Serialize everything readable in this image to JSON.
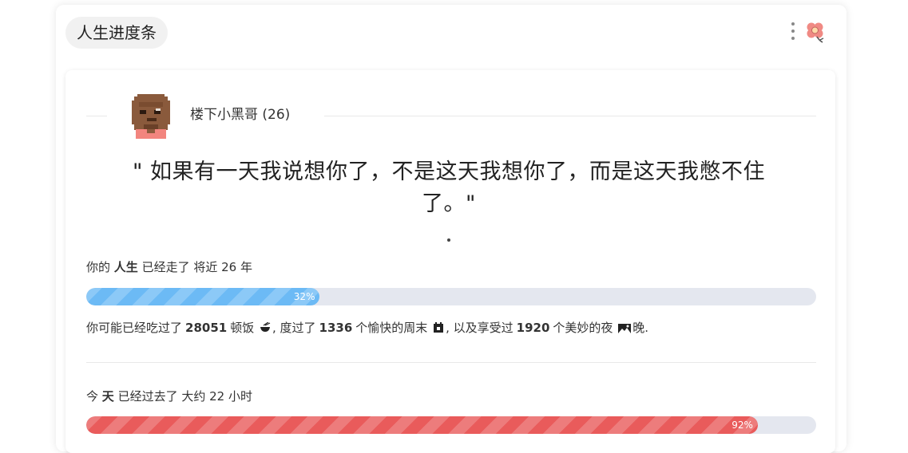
{
  "app": {
    "title": "人生进度条"
  },
  "header_icons": {
    "menu_icon": "kebab-vertical-icon",
    "flower_icon": "flower-icon"
  },
  "profile": {
    "name_line": "楼下小黑哥 (26)"
  },
  "quote": {
    "line1": "\" 如果有一天我说想你了，不是这天我想你了，而是这天我憋不住",
    "line2": "了。\""
  },
  "life": {
    "prefix": "你的",
    "keyword": "人生",
    "suffix": "已经走了 将近 26 年",
    "progress_percent": 32,
    "progress_label": "32%",
    "color": "#6cbaf5"
  },
  "stats": {
    "p1": "你可能已经吃过了",
    "meals": "28051",
    "p2": "顿饭",
    "p3": ", 度过了",
    "weekends": "1336",
    "p4": "个愉快的周末",
    "p5": ", 以及享受过",
    "nights": "1920",
    "p6": "个美妙的夜",
    "p7": "晚."
  },
  "today": {
    "prefix": "今",
    "keyword": "天",
    "suffix": "已经过去了 大约 22 小时",
    "progress_percent": 92,
    "progress_label": "92%",
    "color": "#e95b5b"
  }
}
